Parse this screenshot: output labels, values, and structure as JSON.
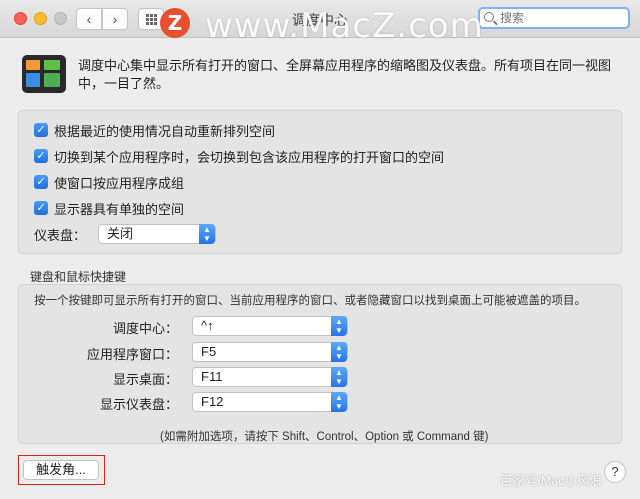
{
  "window": {
    "title": "调度中心"
  },
  "search": {
    "placeholder": "搜索"
  },
  "watermark": {
    "logo_letter": "Z",
    "site": "www.MacZ.com",
    "footer": "百家号/Mac小风浪"
  },
  "description": "调度中心集中显示所有打开的窗口、全屏幕应用程序的缩略图及仪表盘。所有项目在同一视图中，一目了然。",
  "options": [
    {
      "label": "根据最近的使用情况自动重新排列空间",
      "checked": true
    },
    {
      "label": "切换到某个应用程序时，会切换到包含该应用程序的打开窗口的空间",
      "checked": true
    },
    {
      "label": "使窗口按应用程序成组",
      "checked": true
    },
    {
      "label": "显示器具有单独的空间",
      "checked": true
    }
  ],
  "dashboard": {
    "label": "仪表盘：",
    "value": "关闭"
  },
  "keyboard": {
    "section_title": "键盘和鼠标快捷键",
    "description": "按一个按键即可显示所有打开的窗口、当前应用程序的窗口、或者隐藏窗口以找到桌面上可能被遮盖的项目。",
    "rows": [
      {
        "label": "调度中心：",
        "value": "^↑"
      },
      {
        "label": "应用程序窗口：",
        "value": "F5"
      },
      {
        "label": "显示桌面：",
        "value": "F11"
      },
      {
        "label": "显示仪表盘：",
        "value": "F12"
      }
    ],
    "note": "(如需附加选项，请按下 Shift、Control、Option 或 Command 键)"
  },
  "buttons": {
    "hot_corners": "触发角...",
    "help": "?",
    "back": "‹",
    "forward": "›"
  },
  "colors": {
    "accent": "#2a78e6",
    "highlight_border": "#d9241a",
    "watermark_logo": "#e84f2f"
  },
  "icons": [
    "back-icon",
    "forward-icon",
    "grid-icon",
    "search-icon",
    "mission-control-app-icon",
    "checkmark-icon",
    "updown-arrows-icon",
    "help-icon"
  ]
}
